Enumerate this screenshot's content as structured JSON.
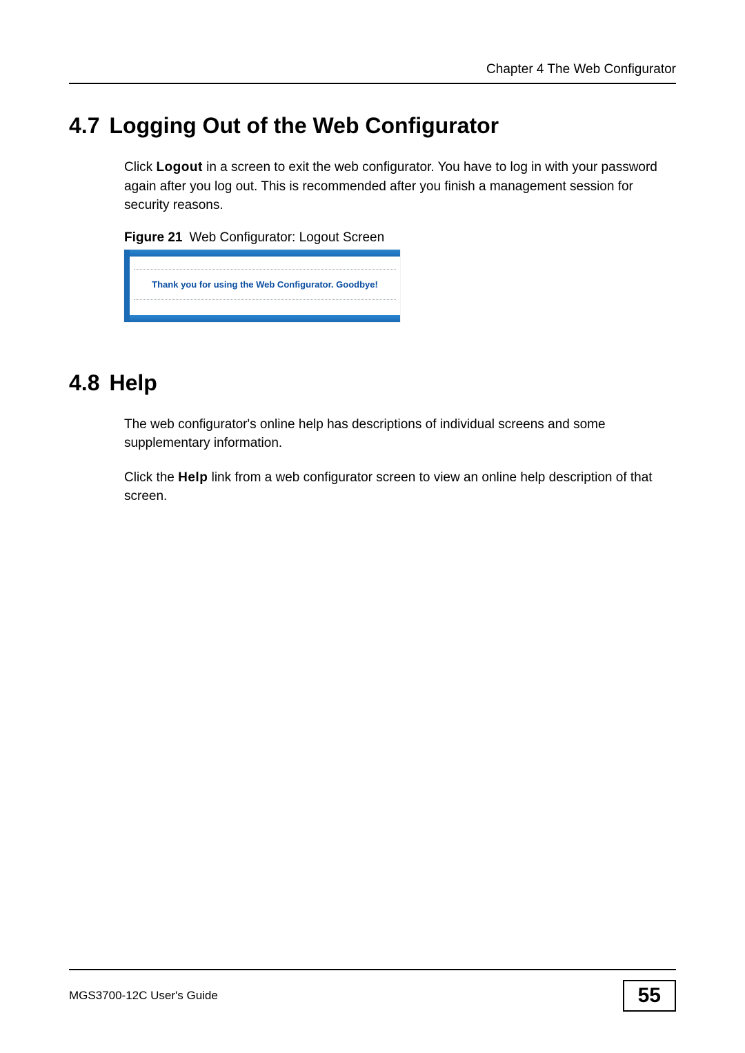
{
  "header": {
    "chapter": "Chapter 4 The Web Configurator"
  },
  "section47": {
    "number": "4.7",
    "title": "Logging Out of the Web Configurator",
    "para_pre": "Click ",
    "para_kw": "Logout",
    "para_post": " in a screen to exit the web configurator. You have to log in with your password again after you log out. This is recommended after you finish a management session for security reasons.",
    "figure_label": "Figure 21",
    "figure_caption": "Web Configurator: Logout Screen",
    "logout_message": "Thank you for using the Web Configurator. Goodbye!"
  },
  "section48": {
    "number": "4.8",
    "title": "Help",
    "para1": "The web configurator's online help has descriptions of individual screens and some supplementary information.",
    "para2_pre": "Click the ",
    "para2_kw": "Help",
    "para2_post": " link from a web configurator screen to view an online help description of that screen."
  },
  "footer": {
    "guide": "MGS3700-12C User's Guide",
    "page": "55"
  }
}
